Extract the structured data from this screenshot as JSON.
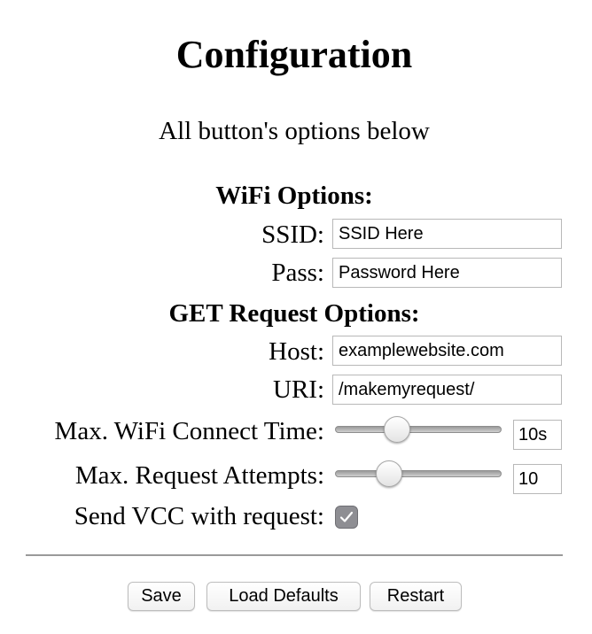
{
  "page": {
    "title": "Configuration",
    "subtitle": "All button's options below"
  },
  "wifi": {
    "heading": "WiFi Options:",
    "ssid_label": "SSID:",
    "ssid_value": "SSID Here",
    "pass_label": "Pass:",
    "pass_value": "Password Here"
  },
  "request": {
    "heading": "GET Request Options:",
    "host_label": "Host:",
    "host_value": "examplewebsite.com",
    "uri_label": "URI:",
    "uri_value": "/makemyrequest/"
  },
  "limits": {
    "connect_time_label": "Max. WiFi Connect Time:",
    "connect_time_value": "10s",
    "connect_time_level": 0.35,
    "attempts_label": "Max. Request Attempts:",
    "attempts_value": "10",
    "attempts_level": 0.29
  },
  "vcc": {
    "label": "Send VCC with request:",
    "checked": true
  },
  "buttons": {
    "save": "Save",
    "load_defaults": "Load Defaults",
    "restart": "Restart"
  },
  "colors": {
    "checkbox_fill": "#8e8e93",
    "divider": "#9a9a9a"
  }
}
